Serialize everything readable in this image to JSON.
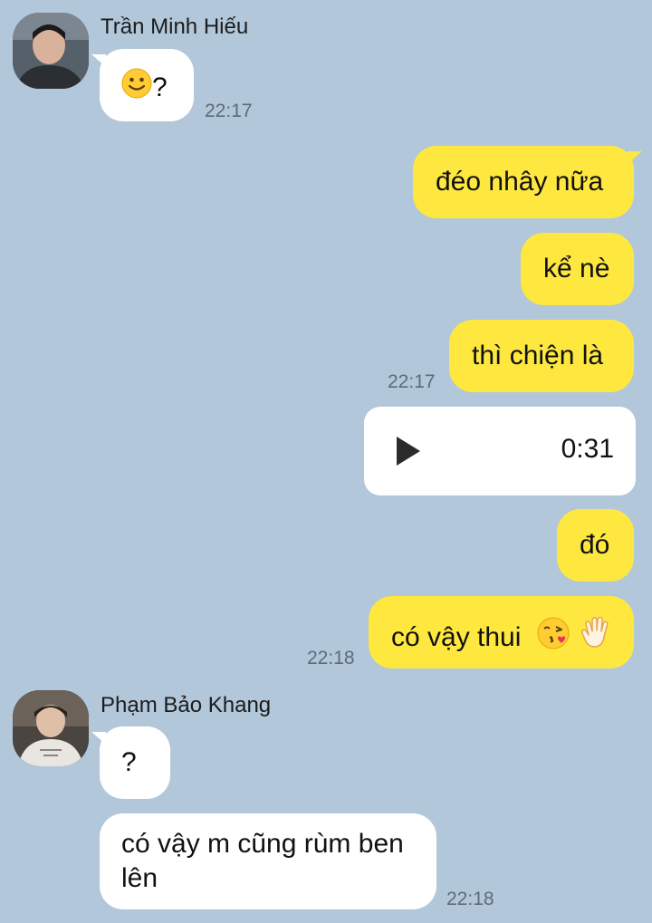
{
  "messages": {
    "sender1": {
      "name": "Trần Minh Hiếu",
      "bubble1_text": "?",
      "bubble1_emoji": "slightly-smiling-face-icon",
      "time": "22:17"
    },
    "me": {
      "msg1": "đéo nhây nữa",
      "msg2": "kể nè",
      "msg3": "thì chiện là",
      "time1": "22:17",
      "voice_duration": "0:31",
      "msg4": "đó",
      "msg5": "có vậy thui",
      "time2": "22:18"
    },
    "sender2": {
      "name": "Phạm Bảo Khang",
      "bubble1_text": "?",
      "bubble2_text": "có vậy m cũng rùm ben lên",
      "time": "22:18"
    }
  },
  "colors": {
    "background": "#b2c7da",
    "outgoing_bubble": "#fee83f",
    "incoming_bubble": "#ffffff"
  }
}
